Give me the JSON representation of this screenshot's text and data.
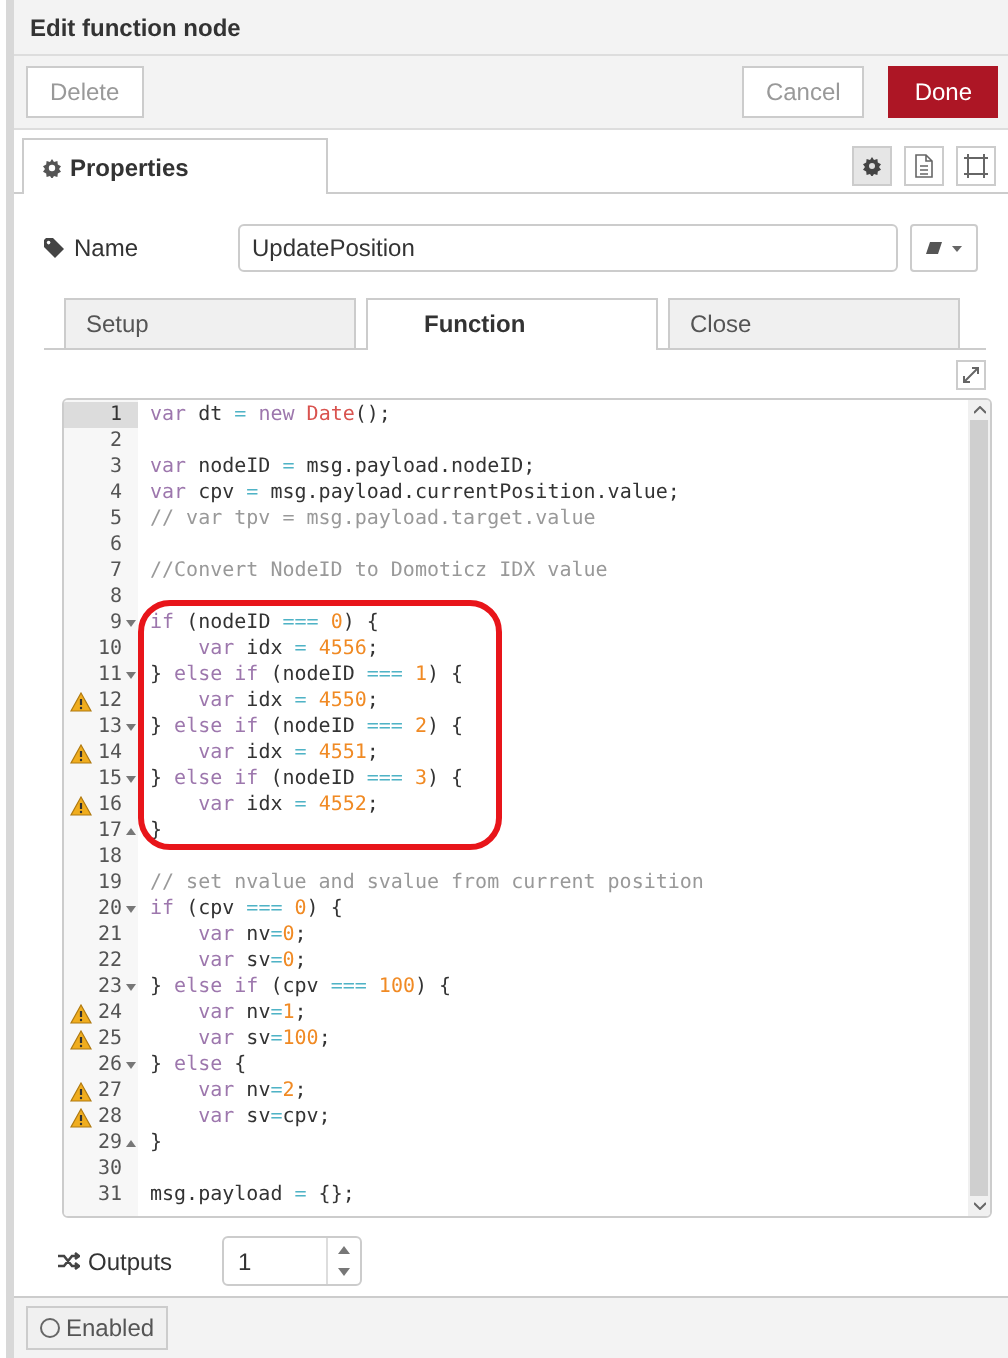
{
  "window": {
    "title": "Edit function node"
  },
  "buttons": [
    {
      "label": "Delete",
      "kind": "plain"
    },
    {
      "label": "Cancel",
      "kind": "plain"
    },
    {
      "label": "Done",
      "kind": "primary"
    }
  ],
  "panel_tabs": [
    {
      "label": "Properties",
      "selected": true
    }
  ],
  "panel_icons": [
    {
      "kind": "settings",
      "selected": true
    },
    {
      "kind": "document",
      "selected": false
    },
    {
      "kind": "frame",
      "selected": false
    }
  ],
  "name_field": {
    "label": "Name",
    "value": "UpdatePosition"
  },
  "editor_tabs": [
    {
      "label": "Setup",
      "selected": false
    },
    {
      "label": "Function",
      "selected": true
    },
    {
      "label": "Close",
      "selected": false
    }
  ],
  "code_blocks": [
    {
      "highlighted": false,
      "lines": [
        {
          "number": "1",
          "current": true,
          "warning": false,
          "fold_open": false,
          "fold_close": false,
          "segs": [
            {
              "kind": "keyword",
              "text": "var"
            },
            {
              "kind": "plain",
              "text": " dt "
            },
            {
              "kind": "operator",
              "text": "= "
            },
            {
              "kind": "keyword",
              "text": "new "
            },
            {
              "kind": "builtin",
              "text": "Date"
            },
            {
              "kind": "plain",
              "text": "();"
            }
          ]
        },
        {
          "number": "2",
          "current": false,
          "warning": false,
          "fold_open": false,
          "fold_close": false
        },
        {
          "number": "3",
          "current": false,
          "warning": false,
          "fold_open": false,
          "fold_close": false,
          "segs": [
            {
              "kind": "keyword",
              "text": "var"
            },
            {
              "kind": "plain",
              "text": " nodeID "
            },
            {
              "kind": "operator",
              "text": "="
            },
            {
              "kind": "plain",
              "text": " msg.payload.nodeID;"
            }
          ]
        },
        {
          "number": "4",
          "current": false,
          "warning": false,
          "fold_open": false,
          "fold_close": false,
          "segs": [
            {
              "kind": "keyword",
              "text": "var"
            },
            {
              "kind": "plain",
              "text": " cpv "
            },
            {
              "kind": "operator",
              "text": "="
            },
            {
              "kind": "plain",
              "text": " msg.payload.currentPosition.value;"
            }
          ]
        },
        {
          "number": "5",
          "current": false,
          "warning": false,
          "fold_open": false,
          "fold_close": false,
          "segs": [
            {
              "kind": "comment",
              "text": "// var tpv = msg.payload.target.value"
            }
          ]
        },
        {
          "number": "6",
          "current": false,
          "warning": false,
          "fold_open": false,
          "fold_close": false
        },
        {
          "number": "7",
          "current": false,
          "warning": false,
          "fold_open": false,
          "fold_close": false,
          "segs": [
            {
              "kind": "comment",
              "text": "//Convert NodeID to Domoticz IDX value"
            }
          ]
        },
        {
          "number": "8",
          "current": false,
          "warning": false,
          "fold_open": false,
          "fold_close": false
        }
      ]
    },
    {
      "highlighted": true,
      "lines": [
        {
          "number": "9",
          "current": false,
          "warning": false,
          "fold_open": true,
          "fold_close": false,
          "segs": [
            {
              "kind": "keyword",
              "text": "if"
            },
            {
              "kind": "plain",
              "text": " (nodeID "
            },
            {
              "kind": "operator",
              "text": "=== "
            },
            {
              "kind": "number",
              "text": "0"
            },
            {
              "kind": "plain",
              "text": ") {"
            }
          ]
        },
        {
          "number": "10",
          "current": false,
          "warning": false,
          "fold_open": false,
          "fold_close": false,
          "segs": [
            {
              "kind": "keyword",
              "text": "    var"
            },
            {
              "kind": "plain",
              "text": " idx "
            },
            {
              "kind": "operator",
              "text": "= "
            },
            {
              "kind": "number",
              "text": "4556"
            },
            {
              "kind": "plain",
              "text": ";"
            }
          ]
        },
        {
          "number": "11",
          "current": false,
          "warning": false,
          "fold_open": true,
          "fold_close": false,
          "segs": [
            {
              "kind": "plain",
              "text": "} "
            },
            {
              "kind": "keyword",
              "text": "else if"
            },
            {
              "kind": "plain",
              "text": " (nodeID "
            },
            {
              "kind": "operator",
              "text": "=== "
            },
            {
              "kind": "number",
              "text": "1"
            },
            {
              "kind": "plain",
              "text": ") {"
            }
          ]
        },
        {
          "number": "12",
          "current": false,
          "warning": true,
          "fold_open": false,
          "fold_close": false,
          "segs": [
            {
              "kind": "keyword",
              "text": "    var"
            },
            {
              "kind": "plain",
              "text": " idx "
            },
            {
              "kind": "operator",
              "text": "= "
            },
            {
              "kind": "number",
              "text": "4550"
            },
            {
              "kind": "plain",
              "text": ";"
            }
          ]
        },
        {
          "number": "13",
          "current": false,
          "warning": false,
          "fold_open": true,
          "fold_close": false,
          "segs": [
            {
              "kind": "plain",
              "text": "} "
            },
            {
              "kind": "keyword",
              "text": "else if"
            },
            {
              "kind": "plain",
              "text": " (nodeID "
            },
            {
              "kind": "operator",
              "text": "=== "
            },
            {
              "kind": "number",
              "text": "2"
            },
            {
              "kind": "plain",
              "text": ") {"
            }
          ]
        },
        {
          "number": "14",
          "current": false,
          "warning": true,
          "fold_open": false,
          "fold_close": false,
          "segs": [
            {
              "kind": "keyword",
              "text": "    var"
            },
            {
              "kind": "plain",
              "text": " idx "
            },
            {
              "kind": "operator",
              "text": "= "
            },
            {
              "kind": "number",
              "text": "4551"
            },
            {
              "kind": "plain",
              "text": ";"
            }
          ]
        },
        {
          "number": "15",
          "current": false,
          "warning": false,
          "fold_open": true,
          "fold_close": false,
          "segs": [
            {
              "kind": "plain",
              "text": "} "
            },
            {
              "kind": "keyword",
              "text": "else if"
            },
            {
              "kind": "plain",
              "text": " (nodeID "
            },
            {
              "kind": "operator",
              "text": "=== "
            },
            {
              "kind": "number",
              "text": "3"
            },
            {
              "kind": "plain",
              "text": ") {"
            }
          ]
        },
        {
          "number": "16",
          "current": false,
          "warning": true,
          "fold_open": false,
          "fold_close": false,
          "segs": [
            {
              "kind": "keyword",
              "text": "    var"
            },
            {
              "kind": "plain",
              "text": " idx "
            },
            {
              "kind": "operator",
              "text": "= "
            },
            {
              "kind": "number",
              "text": "4552"
            },
            {
              "kind": "plain",
              "text": ";"
            }
          ]
        },
        {
          "number": "17",
          "current": false,
          "warning": false,
          "fold_open": false,
          "fold_close": true,
          "segs": [
            {
              "kind": "plain",
              "text": "}"
            }
          ]
        }
      ]
    },
    {
      "highlighted": false,
      "lines": [
        {
          "number": "18",
          "current": false,
          "warning": false,
          "fold_open": false,
          "fold_close": false
        },
        {
          "number": "19",
          "current": false,
          "warning": false,
          "fold_open": false,
          "fold_close": false,
          "segs": [
            {
              "kind": "comment",
              "text": "// set nvalue and svalue from current position"
            }
          ]
        },
        {
          "number": "20",
          "current": false,
          "warning": false,
          "fold_open": true,
          "fold_close": false,
          "segs": [
            {
              "kind": "keyword",
              "text": "if"
            },
            {
              "kind": "plain",
              "text": " (cpv "
            },
            {
              "kind": "operator",
              "text": "=== "
            },
            {
              "kind": "number",
              "text": "0"
            },
            {
              "kind": "plain",
              "text": ") {"
            }
          ]
        },
        {
          "number": "21",
          "current": false,
          "warning": false,
          "fold_open": false,
          "fold_close": false,
          "segs": [
            {
              "kind": "keyword",
              "text": "    var"
            },
            {
              "kind": "plain",
              "text": " nv"
            },
            {
              "kind": "operator",
              "text": "="
            },
            {
              "kind": "number",
              "text": "0"
            },
            {
              "kind": "plain",
              "text": ";"
            }
          ]
        },
        {
          "number": "22",
          "current": false,
          "warning": false,
          "fold_open": false,
          "fold_close": false,
          "segs": [
            {
              "kind": "keyword",
              "text": "    var"
            },
            {
              "kind": "plain",
              "text": " sv"
            },
            {
              "kind": "operator",
              "text": "="
            },
            {
              "kind": "number",
              "text": "0"
            },
            {
              "kind": "plain",
              "text": ";"
            }
          ]
        },
        {
          "number": "23",
          "current": false,
          "warning": false,
          "fold_open": true,
          "fold_close": false,
          "segs": [
            {
              "kind": "plain",
              "text": "} "
            },
            {
              "kind": "keyword",
              "text": "else if"
            },
            {
              "kind": "plain",
              "text": " (cpv "
            },
            {
              "kind": "operator",
              "text": "=== "
            },
            {
              "kind": "number",
              "text": "100"
            },
            {
              "kind": "plain",
              "text": ") {"
            }
          ]
        },
        {
          "number": "24",
          "current": false,
          "warning": true,
          "fold_open": false,
          "fold_close": false,
          "segs": [
            {
              "kind": "keyword",
              "text": "    var"
            },
            {
              "kind": "plain",
              "text": " nv"
            },
            {
              "kind": "operator",
              "text": "="
            },
            {
              "kind": "number",
              "text": "1"
            },
            {
              "kind": "plain",
              "text": ";"
            }
          ]
        },
        {
          "number": "25",
          "current": false,
          "warning": true,
          "fold_open": false,
          "fold_close": false,
          "segs": [
            {
              "kind": "keyword",
              "text": "    var"
            },
            {
              "kind": "plain",
              "text": " sv"
            },
            {
              "kind": "operator",
              "text": "="
            },
            {
              "kind": "number",
              "text": "100"
            },
            {
              "kind": "plain",
              "text": ";"
            }
          ]
        },
        {
          "number": "26",
          "current": false,
          "warning": false,
          "fold_open": true,
          "fold_close": false,
          "segs": [
            {
              "kind": "plain",
              "text": "} "
            },
            {
              "kind": "keyword",
              "text": "else"
            },
            {
              "kind": "plain",
              "text": " {"
            }
          ]
        },
        {
          "number": "27",
          "current": false,
          "warning": true,
          "fold_open": false,
          "fold_close": false,
          "segs": [
            {
              "kind": "keyword",
              "text": "    var"
            },
            {
              "kind": "plain",
              "text": " nv"
            },
            {
              "kind": "operator",
              "text": "="
            },
            {
              "kind": "number",
              "text": "2"
            },
            {
              "kind": "plain",
              "text": ";"
            }
          ]
        },
        {
          "number": "28",
          "current": false,
          "warning": true,
          "fold_open": false,
          "fold_close": false,
          "segs": [
            {
              "kind": "keyword",
              "text": "    var"
            },
            {
              "kind": "plain",
              "text": " sv"
            },
            {
              "kind": "operator",
              "text": "="
            },
            {
              "kind": "plain",
              "text": "cpv;"
            }
          ]
        },
        {
          "number": "29",
          "current": false,
          "warning": false,
          "fold_open": false,
          "fold_close": true,
          "segs": [
            {
              "kind": "plain",
              "text": "}"
            }
          ]
        },
        {
          "number": "30",
          "current": false,
          "warning": false,
          "fold_open": false,
          "fold_close": false
        },
        {
          "number": "31",
          "current": false,
          "warning": false,
          "fold_open": false,
          "fold_close": false,
          "segs": [
            {
              "kind": "plain",
              "text": "msg.payload "
            },
            {
              "kind": "operator",
              "text": "= "
            },
            {
              "kind": "plain",
              "text": "{};"
            }
          ]
        }
      ]
    }
  ],
  "outputs": {
    "label": "Outputs",
    "value": "1"
  },
  "footer": {
    "label": "Enabled",
    "on": false
  }
}
